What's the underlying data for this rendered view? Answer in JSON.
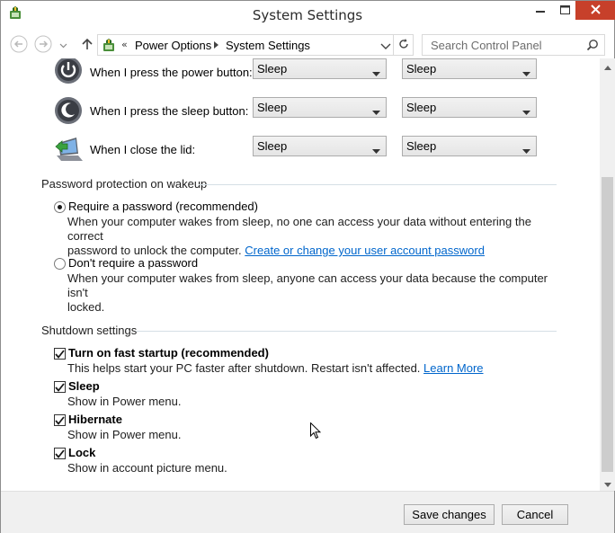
{
  "window": {
    "title": "System Settings",
    "icons": {
      "app": "power-options-icon",
      "minimize": "minimize-icon",
      "maximize": "maximize-icon",
      "close": "close-icon"
    }
  },
  "navigation": {
    "back_icon": "back-arrow-icon",
    "forward_icon": "forward-arrow-icon",
    "recent_icon": "chevron-down-icon",
    "up_icon": "up-arrow-icon",
    "overflow": "«",
    "breadcrumbs": [
      "Power Options",
      "System Settings"
    ],
    "refresh_icon": "refresh-icon",
    "search_placeholder": "Search Control Panel"
  },
  "power_buttons": {
    "rows": [
      {
        "label": "When I press the power button:",
        "icon": "power-button-icon",
        "battery": "Sleep",
        "plugged_in": "Sleep"
      },
      {
        "label": "When I press the sleep button:",
        "icon": "sleep-button-icon",
        "battery": "Sleep",
        "plugged_in": "Sleep"
      },
      {
        "label": "When I close the lid:",
        "icon": "laptop-lid-icon",
        "battery": "Sleep",
        "plugged_in": "Sleep"
      }
    ]
  },
  "password": {
    "title": "Password protection on wakeup",
    "require": {
      "label": "Require a password (recommended)",
      "selected": true,
      "desc_line1": "When your computer wakes from sleep, no one can access your data without entering the correct",
      "desc_line2": "password to unlock the computer.",
      "link": "Create or change your user account password"
    },
    "no_require": {
      "label": "Don't require a password",
      "selected": false,
      "desc_line1": "When your computer wakes from sleep, anyone can access your data because the computer isn't",
      "desc_line2": "locked."
    }
  },
  "shutdown": {
    "title": "Shutdown settings",
    "fast_startup": {
      "label": "Turn on fast startup (recommended)",
      "checked": true,
      "desc": "This helps start your PC faster after shutdown. Restart isn't affected.",
      "link": "Learn More"
    },
    "sleep": {
      "label": "Sleep",
      "checked": true,
      "desc": "Show in Power menu."
    },
    "hibernate": {
      "label": "Hibernate",
      "checked": true,
      "desc": "Show in Power menu."
    },
    "lock": {
      "label": "Lock",
      "checked": true,
      "desc": "Show in account picture menu."
    }
  },
  "footer": {
    "save": "Save changes",
    "cancel": "Cancel"
  },
  "colors": {
    "close_button": "#c7402a",
    "link": "#0066cc",
    "footer_bg": "#f0f0f0"
  }
}
